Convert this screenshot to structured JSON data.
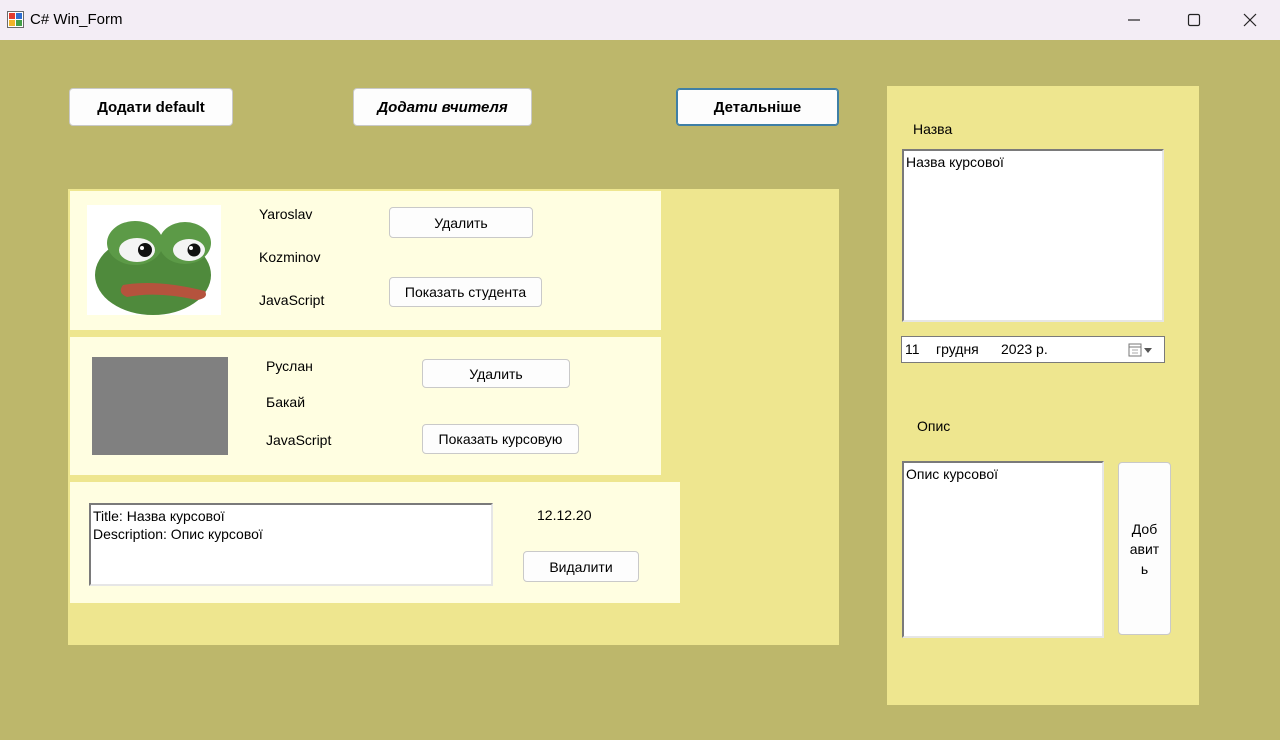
{
  "window": {
    "title": "C# Win_Form",
    "minimize_glyph": "—",
    "close_glyph": "✕"
  },
  "toolbar": {
    "add_default_label": "Додати default",
    "add_teacher_label": "Додати вчителя",
    "details_label": "Детальніше"
  },
  "cards": [
    {
      "first_name": "Yaroslav",
      "last_name": "Kozminov",
      "language": "JavaScript",
      "delete_label": "Удалить",
      "show_label": "Показать студента",
      "avatar": "frog-image"
    },
    {
      "first_name": "Руслан",
      "last_name": "Бакай",
      "language": "JavaScript",
      "delete_label": "Удалить",
      "show_label": "Показать курсовую",
      "avatar": "gray-placeholder"
    }
  ],
  "coursework_card": {
    "text": "Title: Назва курсової\nDescription: Опис курсової",
    "date": "12.12.20",
    "delete_label": "Видалити"
  },
  "side_panel": {
    "name_label": "Назва",
    "name_value": "Назва курсової",
    "date": {
      "day": "11",
      "month": "грудня",
      "year": "2023 р."
    },
    "desc_label": "Опис",
    "desc_value": "Опис курсової",
    "add_label": "Доб\nавит\nь"
  },
  "colors": {
    "form_bg": "#bdb76b",
    "panel_bg": "#eee68f",
    "card_bg": "#fffee1",
    "placeholder_gray": "#808080"
  }
}
